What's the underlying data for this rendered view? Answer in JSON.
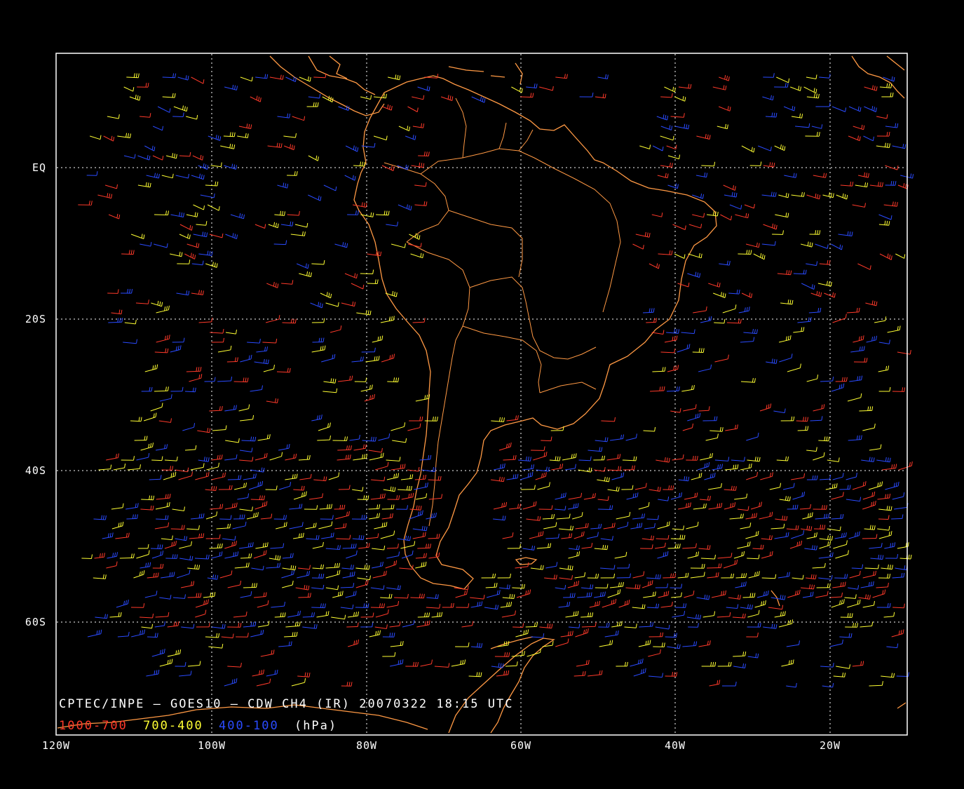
{
  "title": "CPTEC/INPE — GOES10 — CDW CH4 (IR) 20070322 18:15 UTC",
  "legend": {
    "items": [
      {
        "label": "1000-700",
        "color": "#ff3a2a"
      },
      {
        "label": "700-400",
        "color": "#ffff33"
      },
      {
        "label": "400-100",
        "color": "#2a4bff"
      }
    ],
    "units": "(hPa)"
  },
  "axes": {
    "lon_labels": [
      "120W",
      "100W",
      "80W",
      "60W",
      "40W",
      "20W"
    ],
    "lat_labels": [
      "EQ",
      "20S",
      "40S",
      "60S"
    ],
    "lon_range": [
      -120,
      -10
    ],
    "lat_range": [
      15,
      -75
    ]
  },
  "colors": {
    "background": "#000000",
    "frame": "#ffffff",
    "coastline": "#ff9944",
    "grid": "#ffffff"
  },
  "map_layers": [
    "south-america-coastline",
    "country-borders",
    "antarctic-peninsula",
    "africa-west-coast",
    "central-america"
  ]
}
